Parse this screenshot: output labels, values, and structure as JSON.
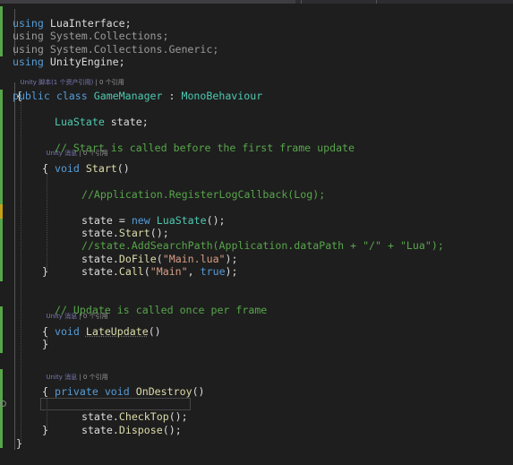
{
  "usings": [
    {
      "keyword": "using",
      "ns": "LuaInterface",
      "end": ";"
    },
    {
      "keyword": "using",
      "ns": "System.Collections",
      "end": ";"
    },
    {
      "keyword": "using",
      "ns": "System.Collections.Generic",
      "end": ";"
    },
    {
      "keyword": "using",
      "ns": "UnityEngine",
      "end": ";"
    }
  ],
  "codelens": {
    "class": {
      "unity": "Unity 脚本(1 个资产引用)",
      "sep": " | ",
      "refs": "0 个引用"
    },
    "start": {
      "unity": "Unity 消息",
      "sep": " | ",
      "refs": "0 个引用"
    },
    "lateupdate": {
      "unity": "Unity 消息",
      "sep": " | ",
      "refs": "0 个引用"
    },
    "ondestroy": {
      "unity": "Unity 消息",
      "sep": " | ",
      "refs": "0 个引用"
    }
  },
  "code": {
    "kw_public": "public",
    "kw_class": "class",
    "class_name": "GameManager",
    "colon": " : ",
    "base_class": "MonoBehaviour",
    "brace_open": "{",
    "brace_close": "}",
    "field_type": "LuaState",
    "field_decl": " state;",
    "comment_start": "// Start is called before the first frame update",
    "kw_void": "void",
    "start_name": "Start",
    "parens": "()",
    "comment_logcallback": "//Application.RegisterLogCallback(Log);",
    "assign_lhs": "state = ",
    "kw_new": "new",
    "luastate_ctor": "LuaState",
    "call_end": "();",
    "state_dot": "state.",
    "m_start": "Start",
    "comment_searchpath": "//state.AddSearchPath(Application.dataPath + \"/\" + \"Lua\");",
    "m_dofile": "DoFile",
    "paren_open": "(",
    "str_main_lua": "\"Main.lua\"",
    "paren_close_semi": ");",
    "m_call": "Call",
    "str_main": "\"Main\"",
    "comma": ", ",
    "kw_true": "true",
    "comment_update": "// Update is called once per frame",
    "lateupdate_name": "LateUpdate",
    "kw_private": "private",
    "ondestroy_name": "OnDestroy",
    "m_checktop": "CheckTop",
    "m_dispose": "Dispose"
  },
  "colors": {
    "background": "#1e1e1e",
    "keyword": "#569cd6",
    "type": "#4ec9b0",
    "string": "#d69d85",
    "comment": "#57a64a",
    "method": "#dcdcaa",
    "text": "#dcdcdc",
    "change_marker_green": "#57a64a",
    "change_marker_yellow": "#c5a218"
  },
  "icons": {
    "breakpoint": "breakpoint-hint-icon",
    "codelens_unity": "unity-icon"
  }
}
